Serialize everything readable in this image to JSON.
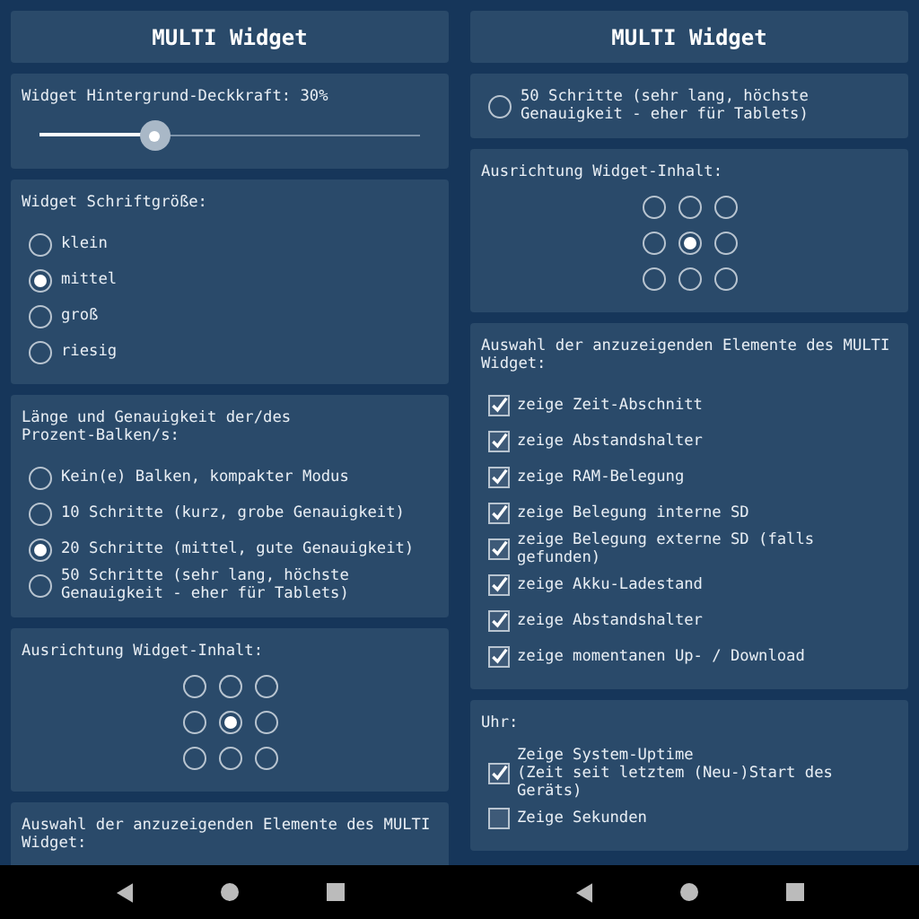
{
  "screens": [
    {
      "title": "MULTI Widget",
      "sections": [
        {
          "kind": "slider",
          "label": "Widget Hintergrund-Deckkraft: 30%",
          "level": 0.3
        },
        {
          "kind": "radio",
          "label": "Widget Schriftgröße:",
          "options": [
            {
              "label": "klein",
              "selected": false
            },
            {
              "label": "mittel",
              "selected": true
            },
            {
              "label": "groß",
              "selected": false
            },
            {
              "label": "riesig",
              "selected": false
            }
          ]
        },
        {
          "kind": "radio",
          "label": "Länge und Genauigkeit der/des\nProzent-Balken/s:",
          "options": [
            {
              "label": "Kein(e) Balken, kompakter Modus",
              "selected": false
            },
            {
              "label": "10 Schritte (kurz, grobe Genauigkeit)",
              "selected": false
            },
            {
              "label": "20 Schritte (mittel, gute Genauigkeit)",
              "selected": true
            },
            {
              "label": "50 Schritte (sehr lang, höchste Genauigkeit - eher für Tablets)",
              "selected": false
            }
          ]
        },
        {
          "kind": "grid",
          "label": "Ausrichtung Widget-Inhalt:",
          "cells": [
            {
              "selected": false
            },
            {
              "selected": false
            },
            {
              "selected": false
            },
            {
              "selected": false
            },
            {
              "selected": true
            },
            {
              "selected": false
            },
            {
              "selected": false
            },
            {
              "selected": false
            },
            {
              "selected": false
            }
          ]
        },
        {
          "kind": "checks",
          "label": "Auswahl der anzuzeigenden Elemente des MULTI Widget:"
        }
      ]
    },
    {
      "title": "MULTI Widget",
      "sections": [
        {
          "kind": "radio",
          "options": [
            {
              "label": "50 Schritte (sehr lang, höchste Genauigkeit - eher für Tablets)",
              "selected": false
            }
          ]
        },
        {
          "kind": "grid",
          "label": "Ausrichtung Widget-Inhalt:",
          "cells": [
            {
              "selected": false
            },
            {
              "selected": false
            },
            {
              "selected": false
            },
            {
              "selected": false
            },
            {
              "selected": true
            },
            {
              "selected": false
            },
            {
              "selected": false
            },
            {
              "selected": false
            },
            {
              "selected": false
            }
          ]
        },
        {
          "kind": "checks",
          "label": "Auswahl der anzuzeigenden Elemente des MULTI Widget:",
          "options": [
            {
              "label": "zeige Zeit-Abschnitt",
              "checked": true
            },
            {
              "label": "zeige Abstandshalter",
              "checked": true
            },
            {
              "label": "zeige RAM-Belegung",
              "checked": true
            },
            {
              "label": "zeige Belegung interne SD",
              "checked": true
            },
            {
              "label": "zeige Belegung externe SD (falls gefunden)",
              "checked": true
            },
            {
              "label": "zeige Akku-Ladestand",
              "checked": true
            },
            {
              "label": "zeige Abstandshalter",
              "checked": true
            },
            {
              "label": "zeige momentanen Up- / Download",
              "checked": true
            }
          ]
        },
        {
          "kind": "checks",
          "label": "Uhr:",
          "options": [
            {
              "label": "Zeige System-Uptime\n(Zeit seit letztem (Neu-)Start des Geräts)",
              "checked": true
            },
            {
              "label": "Zeige Sekunden",
              "checked": false
            }
          ]
        }
      ]
    }
  ]
}
